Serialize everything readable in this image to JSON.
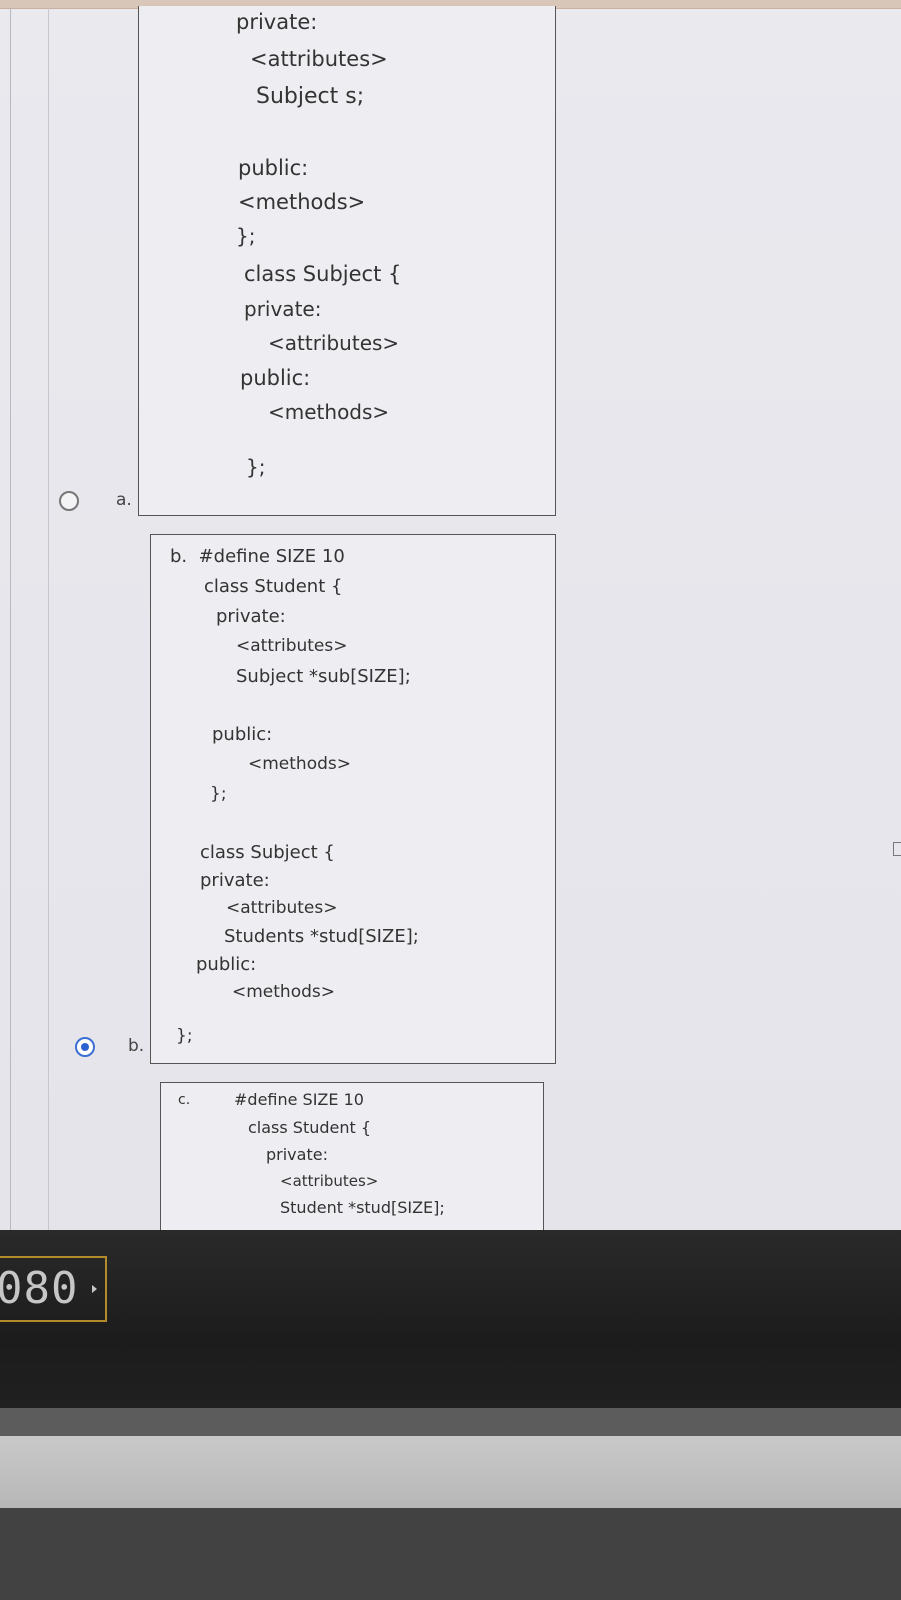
{
  "options": {
    "a": {
      "letter": "a.",
      "selected": false,
      "code": {
        "l1": "private:",
        "l2": "<attributes>",
        "l3": "Subject s;",
        "l4": "public:",
        "l5": "<methods>",
        "l6": "};",
        "l7": "class Subject {",
        "l8": "private:",
        "l9": "<attributes>",
        "l10": "public:",
        "l11": "<methods>",
        "l12": "};"
      }
    },
    "b": {
      "letter": "b.",
      "selected": true,
      "code": {
        "l1": "b.  #define SIZE 10",
        "l2": "class Student {",
        "l3": "private:",
        "l4": "<attributes>",
        "l5": "Subject *sub[SIZE];",
        "l6": "public:",
        "l7": "<methods>",
        "l8": "};",
        "l9": "class Subject {",
        "l10": "private:",
        "l11": "<attributes>",
        "l12": "Students *stud[SIZE];",
        "l13": "public:",
        "l14": "<methods>",
        "l15": "};"
      }
    },
    "c": {
      "code": {
        "l1": "c.",
        "l2": "#define SIZE 10",
        "l3": "class Student {",
        "l4": "private:",
        "l5": "<attributes>",
        "l6": "Student *stud[SIZE];"
      }
    }
  },
  "device": {
    "counter_text": "080"
  },
  "colors": {
    "radio_selected": "#2d62d1",
    "counter_border": "#b58a2b"
  }
}
